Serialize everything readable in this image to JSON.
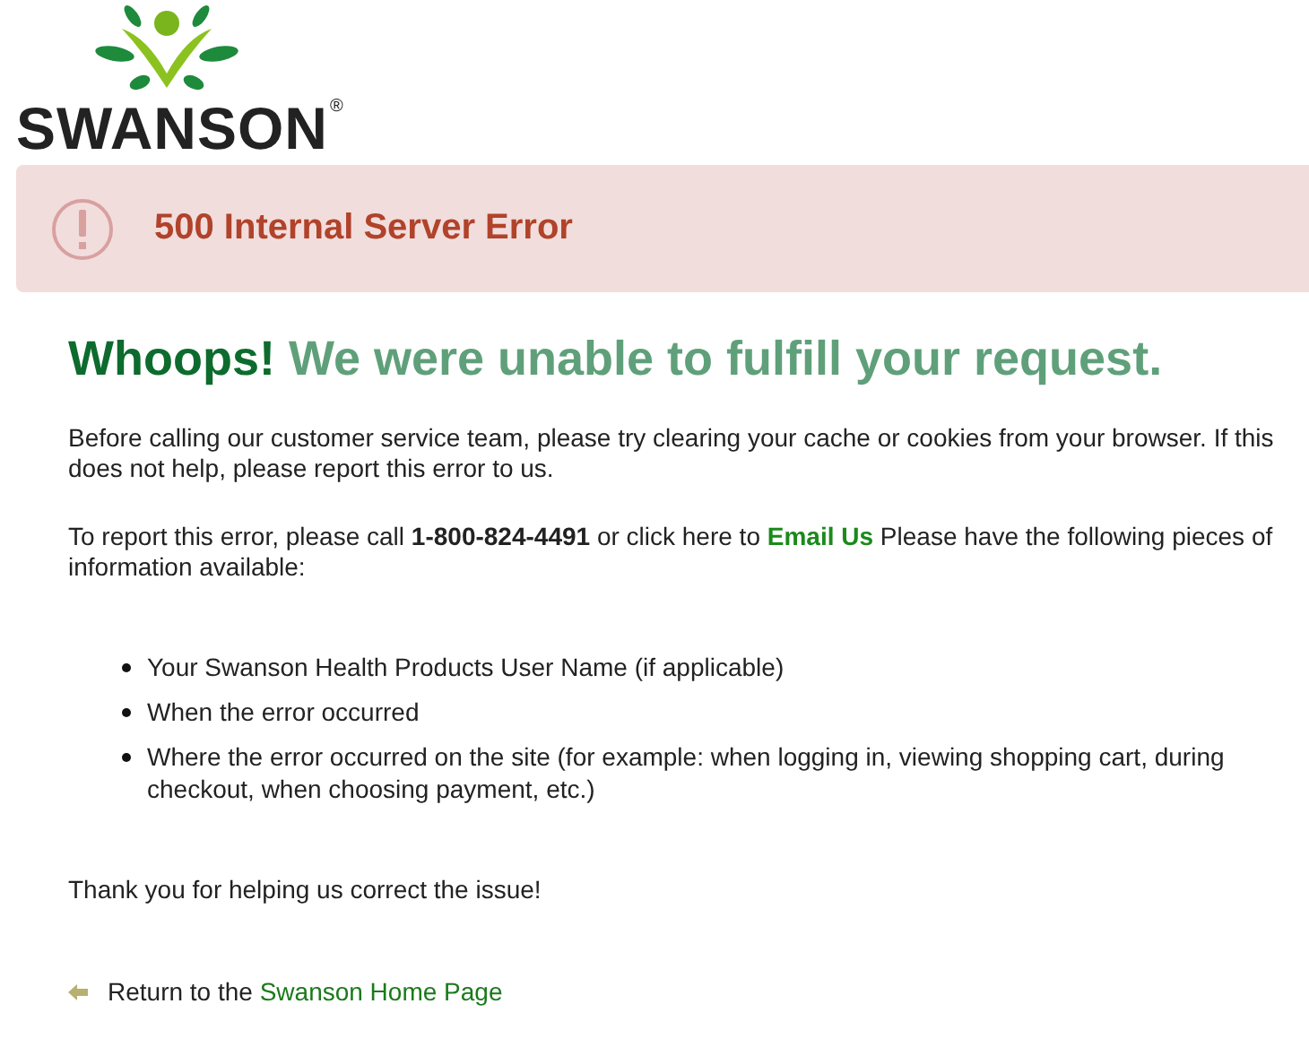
{
  "logo": {
    "wordmark": "SWANSON",
    "mark": "®"
  },
  "alert": {
    "title": "500 Internal Server Error"
  },
  "headline": {
    "lead": "Whoops!",
    "rest": "We were unable to fulfill your request."
  },
  "intro": "Before calling our customer service team, please try clearing your cache or cookies from your browser. If this does not help, please report this error to us.",
  "report": {
    "before": "To report this error, please call **1-800-824-4491** or click here to",
    "link": "Email Us",
    "after": "Please have the following pieces of information available:"
  },
  "bullets": [
    "Your Swanson Health Products User Name (if applicable)",
    "When the error occurred",
    "Where the error occurred on the site (for example: when logging in, viewing shopping cart, during checkout, when choosing payment, etc.)"
  ],
  "thanks": "Thank you for helping us correct the issue!",
  "return": {
    "text": "Return to the",
    "link": "Swanson Home Page"
  }
}
